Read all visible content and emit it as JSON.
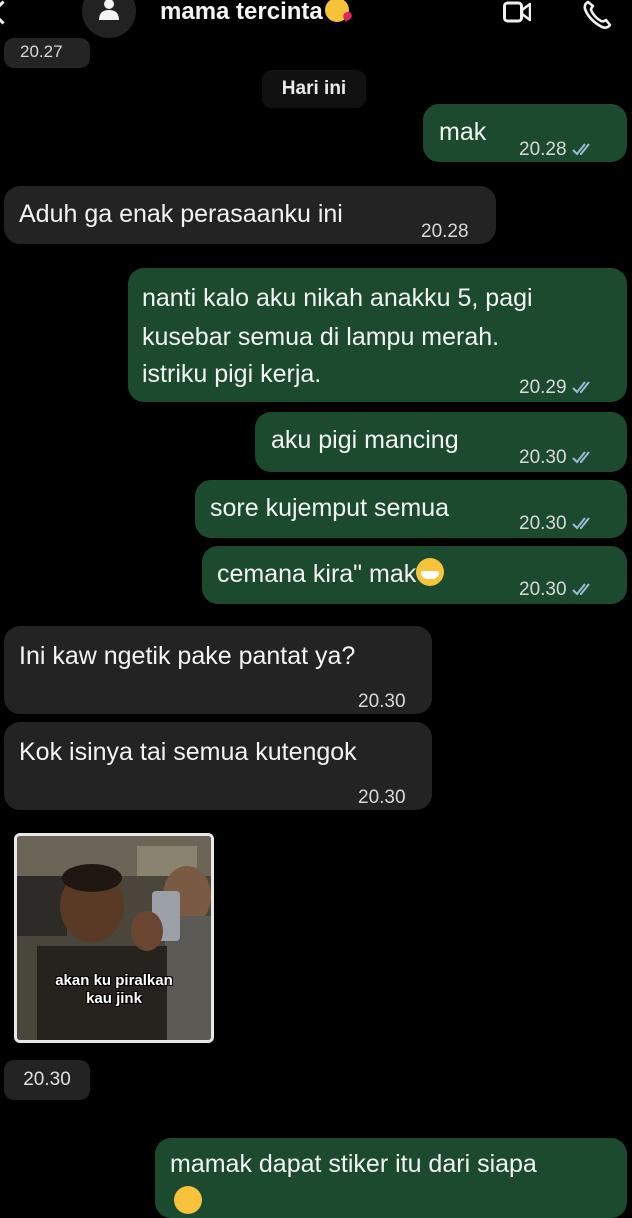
{
  "header": {
    "contact_name": "mama tercinta",
    "back_icon": "chevron-left-icon",
    "avatar_icon": "person-icon",
    "video_icon": "video-camera-icon",
    "call_icon": "phone-icon"
  },
  "top_timestamp": "20.27",
  "date_separator": "Hari ini",
  "colors": {
    "background": "#000000",
    "outgoing_bubble": "#1c4a2f",
    "incoming_bubble": "#232323",
    "read_ticks": "#9fb9d6"
  },
  "messages": [
    {
      "direction": "out",
      "lines": [
        "mak"
      ],
      "time": "20.28",
      "status": "read"
    },
    {
      "direction": "in",
      "lines": [
        "Aduh ga enak perasaanku ini"
      ],
      "time": "20.28"
    },
    {
      "direction": "out",
      "lines": [
        "nanti kalo aku nikah anakku 5, pagi",
        "kusebar semua di lampu merah.",
        "istriku pigi kerja."
      ],
      "time": "20.29",
      "status": "read"
    },
    {
      "direction": "out",
      "lines": [
        "aku pigi mancing"
      ],
      "time": "20.30",
      "status": "read"
    },
    {
      "direction": "out",
      "lines": [
        "sore kujemput semua"
      ],
      "time": "20.30",
      "status": "read"
    },
    {
      "direction": "out",
      "lines": [
        "cemana kira\" mak"
      ],
      "emoji": "grinning-face",
      "time": "20.30",
      "status": "read"
    },
    {
      "direction": "in",
      "lines": [
        "Ini kaw ngetik pake pantat ya?"
      ],
      "time": "20.30"
    },
    {
      "direction": "in",
      "lines": [
        "Kok isinya tai semua kutengok"
      ],
      "time": "20.30"
    },
    {
      "direction": "in",
      "type": "sticker",
      "caption": [
        "akan ku piralkan",
        "kau jink"
      ],
      "time": "20.30"
    },
    {
      "direction": "out",
      "lines": [
        "mamak dapat stiker itu dari siapa"
      ],
      "emoji": "grinning-face"
    }
  ]
}
